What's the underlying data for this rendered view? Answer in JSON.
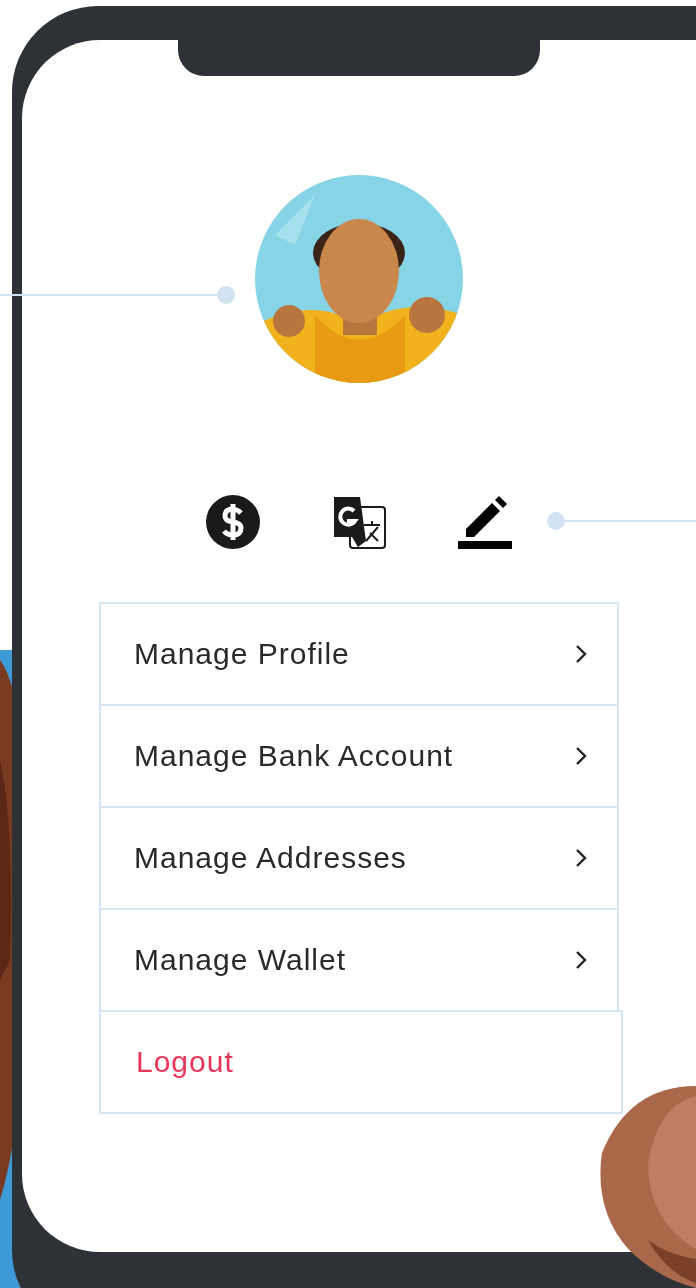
{
  "menu": [
    {
      "label": "Manage Profile",
      "kind": "nav"
    },
    {
      "label": "Manage Bank Account",
      "kind": "nav"
    },
    {
      "label": "Manage Addresses",
      "kind": "nav"
    },
    {
      "label": "Manage Wallet",
      "kind": "nav"
    },
    {
      "label": "Logout",
      "kind": "logout"
    }
  ]
}
